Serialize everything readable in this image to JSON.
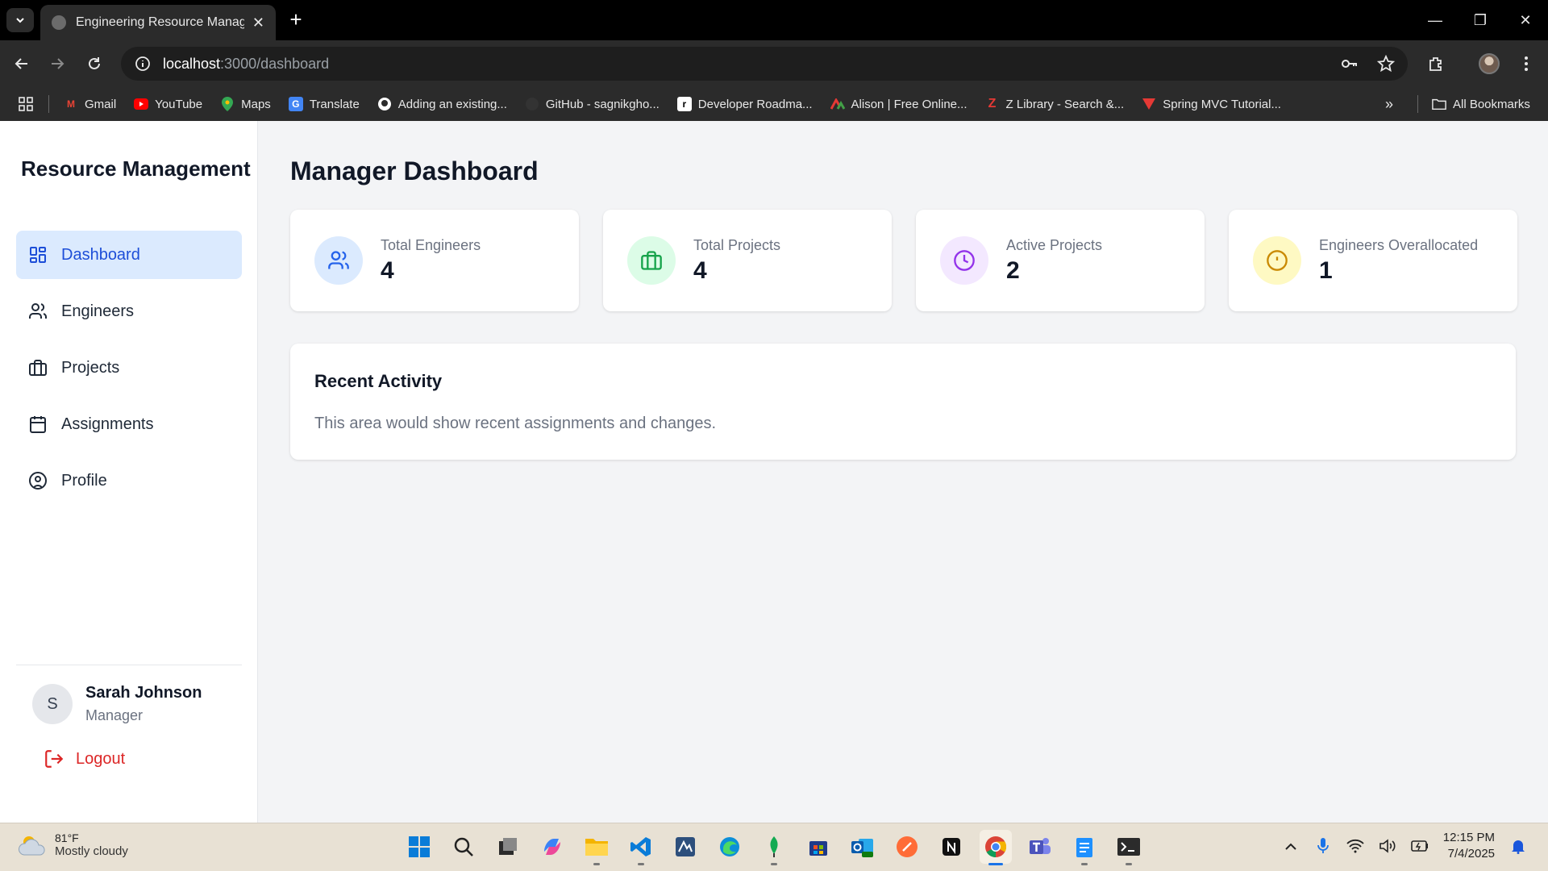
{
  "browser": {
    "tab_title": "Engineering Resource Managem",
    "url_host": "localhost",
    "url_path": ":3000/dashboard",
    "bookmarks": [
      {
        "label": "Gmail",
        "icon": "gmail-icon",
        "color": "#ea4335"
      },
      {
        "label": "YouTube",
        "icon": "youtube-icon",
        "color": "#ff0000"
      },
      {
        "label": "Maps",
        "icon": "maps-icon",
        "color": "#34a853"
      },
      {
        "label": "Translate",
        "icon": "translate-icon",
        "color": "#4285f4"
      },
      {
        "label": "Adding an existing...",
        "icon": "github-icon",
        "color": "#ffffff"
      },
      {
        "label": "GitHub - sagnikgho...",
        "icon": "github-icon",
        "color": "#333333"
      },
      {
        "label": "Developer Roadma...",
        "icon": "roadmap-icon",
        "color": "#ffffff"
      },
      {
        "label": "Alison | Free Online...",
        "icon": "alison-icon",
        "color": "#e53935"
      },
      {
        "label": "Z Library - Search &...",
        "icon": "zlibrary-icon",
        "color": "#e53935"
      },
      {
        "label": "Spring MVC Tutorial...",
        "icon": "spring-icon",
        "color": "#e53935"
      }
    ],
    "all_bookmarks": "All Bookmarks"
  },
  "sidebar": {
    "brand": "Resource Management",
    "items": [
      {
        "label": "Dashboard",
        "icon": "dashboard-icon",
        "active": true
      },
      {
        "label": "Engineers",
        "icon": "users-icon",
        "active": false
      },
      {
        "label": "Projects",
        "icon": "briefcase-icon",
        "active": false
      },
      {
        "label": "Assignments",
        "icon": "calendar-icon",
        "active": false
      },
      {
        "label": "Profile",
        "icon": "user-circle-icon",
        "active": false
      }
    ],
    "user": {
      "initial": "S",
      "name": "Sarah Johnson",
      "role": "Manager"
    },
    "logout": "Logout"
  },
  "main": {
    "title": "Manager Dashboard",
    "stats": [
      {
        "label": "Total Engineers",
        "value": "4",
        "icon": "users-icon",
        "bg": "#dbeafe",
        "fg": "#2563eb"
      },
      {
        "label": "Total Projects",
        "value": "4",
        "icon": "briefcase-icon",
        "bg": "#dcfce7",
        "fg": "#16a34a"
      },
      {
        "label": "Active Projects",
        "value": "2",
        "icon": "clock-icon",
        "bg": "#f3e8ff",
        "fg": "#9333ea"
      },
      {
        "label": "Engineers Overallocated",
        "value": "1",
        "icon": "alert-icon",
        "bg": "#fef9c3",
        "fg": "#ca8a04"
      }
    ],
    "activity": {
      "title": "Recent Activity",
      "text": "This area would show recent assignments and changes."
    }
  },
  "taskbar": {
    "weather_temp": "81°F",
    "weather_desc": "Mostly cloudy",
    "time": "12:15 PM",
    "date": "7/4/2025"
  },
  "colors": {
    "accent": "#1d4ed8",
    "active_bg": "#dbeafe",
    "logout": "#dc2626"
  }
}
